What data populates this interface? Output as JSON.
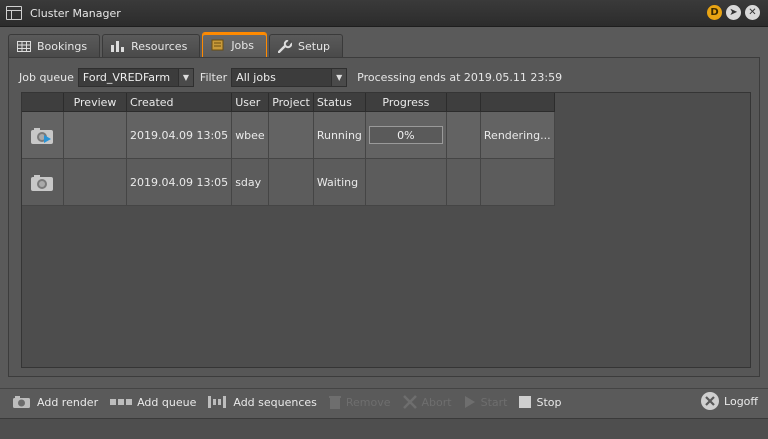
{
  "window": {
    "title": "Cluster Manager",
    "badge": "D"
  },
  "tabs": [
    {
      "label": "Bookings",
      "icon": "table-icon"
    },
    {
      "label": "Resources",
      "icon": "bar-chart-icon"
    },
    {
      "label": "Jobs",
      "icon": "jobs-icon",
      "active": true
    },
    {
      "label": "Setup",
      "icon": "wrench-icon"
    }
  ],
  "filters": {
    "job_queue_label": "Job queue",
    "job_queue_value": "Ford_VREDFarm",
    "filter_label": "Filter",
    "filter_value": "All jobs",
    "status": "Processing ends at 2019.05.11 23:59"
  },
  "table": {
    "columns": [
      "",
      "Preview",
      "Created",
      "User",
      "Project",
      "Status",
      "Progress",
      "",
      ""
    ],
    "rows": [
      {
        "icon": "camera-play-icon",
        "preview": "",
        "created": "2019.04.09 13:05",
        "user": "wbee",
        "project": "",
        "status": "Running",
        "progress": "0%",
        "extra": "",
        "message": "Rendering..."
      },
      {
        "icon": "camera-icon",
        "preview": "",
        "created": "2019.04.09 13:05",
        "user": "sday",
        "project": "",
        "status": "Waiting",
        "progress": "",
        "extra": "",
        "message": ""
      }
    ]
  },
  "toolbar": {
    "add_render": "Add render",
    "add_queue": "Add queue",
    "add_sequences": "Add sequences",
    "remove": "Remove",
    "abort": "Abort",
    "start": "Start",
    "stop": "Stop",
    "logoff": "Logoff"
  },
  "colors": {
    "accent": "#ff8a00",
    "badge": "#e9a413"
  }
}
